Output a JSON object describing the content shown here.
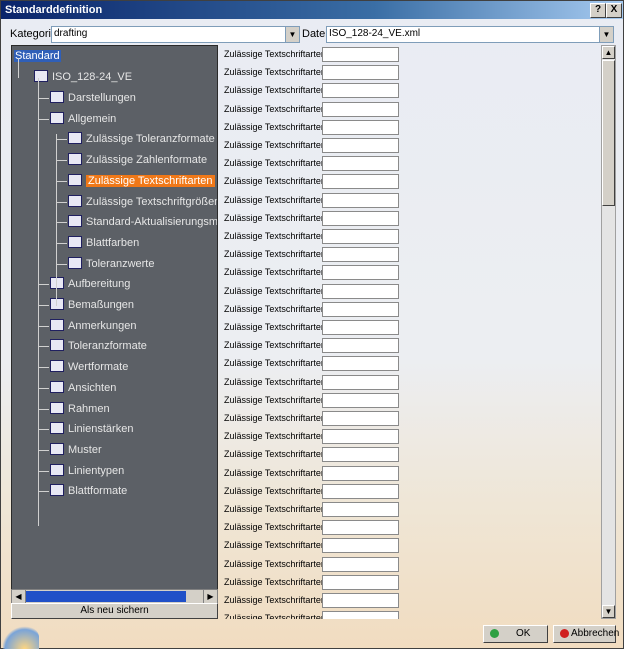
{
  "window": {
    "title": "Standarddefinition",
    "help_label": "?",
    "close_label": "X"
  },
  "top_bar": {
    "category_label": "Kategorie:",
    "category_value": "drafting",
    "file_label": "Datei:",
    "file_value": "ISO_128-24_VE.xml"
  },
  "tree": {
    "root": "Standard",
    "doc": "ISO_128-24_VE",
    "items": [
      {
        "label": "Darstellungen",
        "level": 2
      },
      {
        "label": "Allgemein",
        "level": 2
      },
      {
        "label": "Zulässige Toleranzformate",
        "level": 3
      },
      {
        "label": "Zulässige Zahlenformate",
        "level": 3
      },
      {
        "label": "Zulässige Textschriftarten",
        "level": 3,
        "selected": true
      },
      {
        "label": "Zulässige Textschriftgrößen",
        "level": 3
      },
      {
        "label": "Standard-Aktualisierungsmig",
        "level": 3
      },
      {
        "label": "Blattfarben",
        "level": 3
      },
      {
        "label": "Toleranzwerte",
        "level": 3
      },
      {
        "label": "Aufbereitung",
        "level": 2
      },
      {
        "label": "Bemaßungen",
        "level": 2
      },
      {
        "label": "Anmerkungen",
        "level": 2
      },
      {
        "label": "Toleranzformate",
        "level": 2
      },
      {
        "label": "Wertformate",
        "level": 2
      },
      {
        "label": "Ansichten",
        "level": 2
      },
      {
        "label": "Rahmen",
        "level": 2
      },
      {
        "label": "Linienstärken",
        "level": 2
      },
      {
        "label": "Muster",
        "level": 2
      },
      {
        "label": "Linientypen",
        "level": 2
      },
      {
        "label": "Blattformate",
        "level": 2
      }
    ]
  },
  "save_new_label": "Als neu sichern",
  "field_label": "Zulässige Textschriftarten",
  "field_count": 32,
  "buttons": {
    "ok": "OK",
    "cancel": "Abbrechen"
  },
  "colors": {
    "selected": "#f07818",
    "tree_bg": "#5c6066",
    "ok_dot": "#2ea043",
    "cancel_dot": "#d02020"
  }
}
